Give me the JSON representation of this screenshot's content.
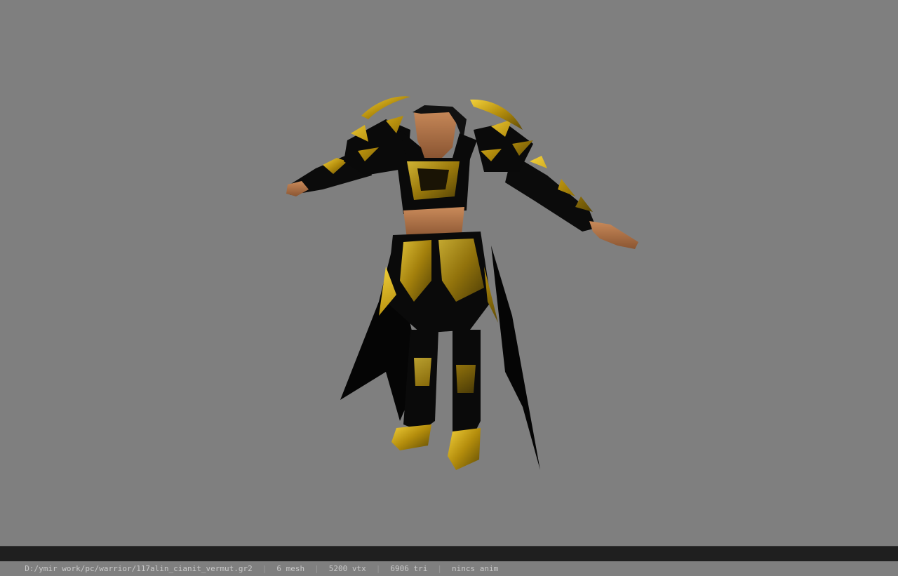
{
  "viewer": {
    "background_color": "#7f7f7f",
    "model_subject": "armored warrior character model (black and gold armor)",
    "status": {
      "file_path": "D:/ymir work/pc/warrior/117alin_cianit_vermut.gr2",
      "mesh_count": "6 mesh",
      "vertex_count": "5200 vtx",
      "triangle_count": "6906 tri",
      "anim_status": "nincs anim",
      "separator": "|"
    }
  }
}
